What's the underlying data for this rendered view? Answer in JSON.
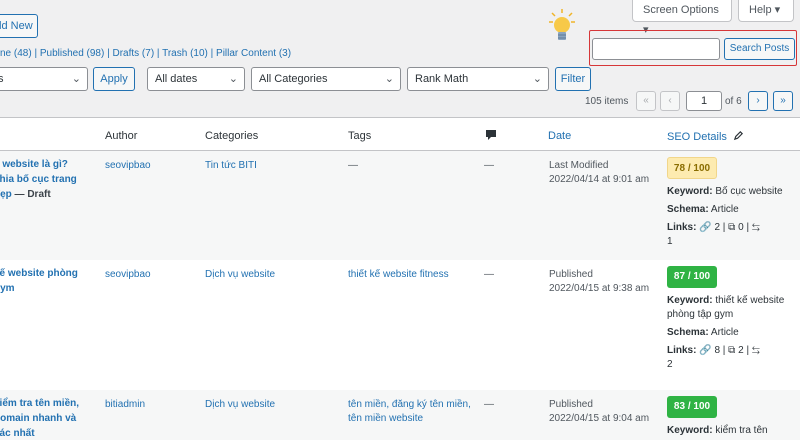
{
  "header": {
    "add_new": "dd New",
    "screen_options": "Screen Options ▾",
    "help": "Help ▾"
  },
  "status_links": "ne (48) | Published (98) | Drafts (7) | Trash (10) | Pillar Content (3)",
  "filters": {
    "bulk_value": "s",
    "apply": "Apply",
    "dates": "All dates",
    "categories": "All Categories",
    "rank_math": "Rank Math",
    "filter": "Filter"
  },
  "search": {
    "value": "",
    "placeholder": "",
    "button": "Search Posts"
  },
  "pagination": {
    "items": "105 items",
    "first": "«",
    "prev": "‹",
    "current": "1",
    "of": "of 6",
    "next": "›",
    "last": "»"
  },
  "columns": {
    "author": "Author",
    "categories": "Categories",
    "tags": "Tags",
    "date": "Date",
    "seo": "SEO Details"
  },
  "rows": [
    {
      "title_lines": [
        "c website là gì?",
        "chia bố cục trang",
        "đẹp"
      ],
      "state": " — Draft",
      "author": "seovipbao",
      "categories": "Tin tức BITI",
      "tags": "—",
      "comments": "—",
      "date_status": "Last Modified",
      "date": "2022/04/14 at 9:01 am",
      "score": "78 / 100",
      "keyword_label": "Keyword:",
      "keyword": "Bố cục website",
      "schema_label": "Schema:",
      "schema": "Article",
      "links_label": "Links:",
      "links": "2 | ⧉ 0 | ⇆",
      "links_extra": "1"
    },
    {
      "title_lines": [
        "kế website phòng",
        "gym"
      ],
      "state": "",
      "author": "seovipbao",
      "categories": "Dịch vụ website",
      "tags": "thiết kế website fitness",
      "comments": "—",
      "date_status": "Published",
      "date": "2022/04/15 at 9:38 am",
      "score": "87 / 100",
      "keyword_label": "Keyword:",
      "keyword": "thiết kế website phòng tập gym",
      "schema_label": "Schema:",
      "schema": "Article",
      "links_label": "Links:",
      "links": "8 | ⧉ 2 | ⇆",
      "links_extra": "2"
    },
    {
      "title_lines": [
        "kiểm tra tên miền,",
        "domain nhanh và",
        "xác nhất"
      ],
      "state": "",
      "author": "bitiadmin",
      "categories": "Dịch vụ website",
      "tags": "tên miền, đăng ký tên miền, tên miền website",
      "comments": "—",
      "date_status": "Published",
      "date": "2022/04/15 at 9:04 am",
      "score": "83 / 100",
      "keyword_label": "Keyword:",
      "keyword": "kiểm tra tên",
      "schema_label": "",
      "schema": "",
      "links_label": "",
      "links": "",
      "links_extra": ""
    }
  ],
  "colors": {
    "link": "#2271b1",
    "score_warn": "#fdebb0",
    "score_good": "#2fb344",
    "search_highlight": "#d63638"
  }
}
